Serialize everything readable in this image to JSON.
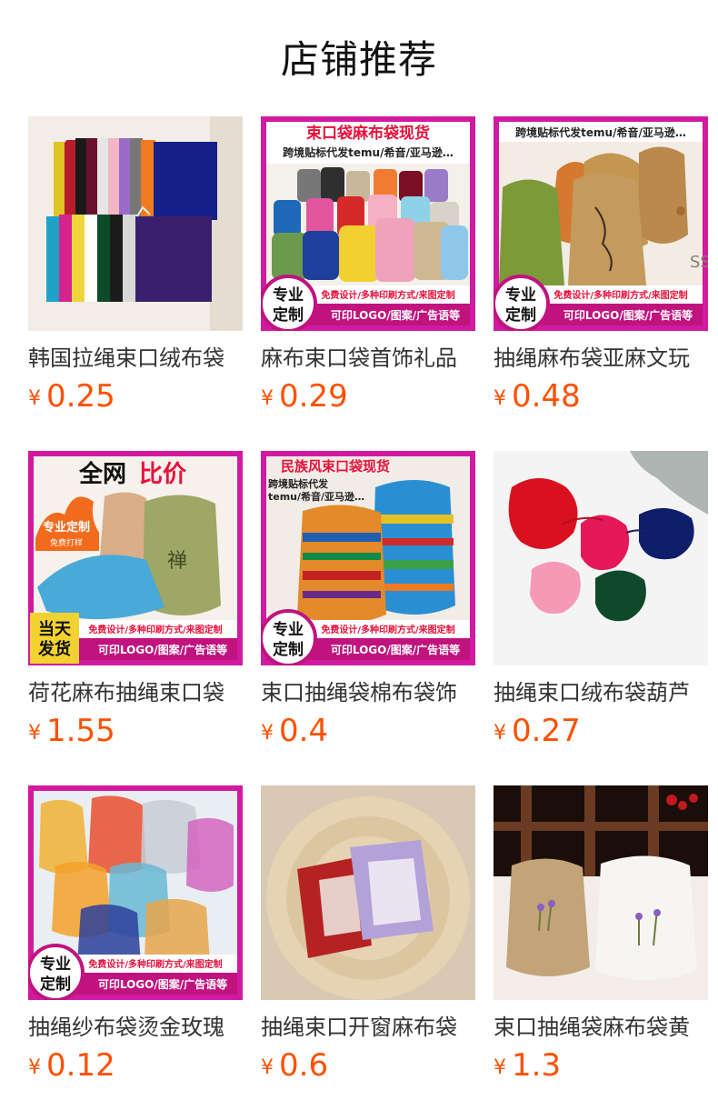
{
  "section_title": "店铺推荐",
  "currency_symbol": "¥",
  "products": [
    {
      "name": "韩国拉绳束口绒布袋",
      "price": "0.25",
      "image": {
        "kind": "velvet-rainbow"
      }
    },
    {
      "name": "麻布束口袋首饰礼品",
      "price": "0.29",
      "image": {
        "kind": "burlap-colors",
        "banner_top": "束口袋麻布袋现货",
        "banner_sub": "跨境贴标代发temu/希音/亚马逊…",
        "badge": "专业定制",
        "strip_top": "免费设计/多种印刷方式/来图定制",
        "strip_bottom": "可印LOGO/图案/广告语等"
      }
    },
    {
      "name": "抽绳麻布袋亚麻文玩",
      "price": "0.48",
      "image": {
        "kind": "linen-bags",
        "banner_sub": "跨境贴标代发temu/希音/亚马逊…",
        "badge": "专业定制",
        "strip_top": "免费设计/多种印刷方式/来图定制",
        "strip_bottom": "可印LOGO/图案/广告语等"
      }
    },
    {
      "name": "荷花麻布抽绳束口袋",
      "price": "1.55",
      "image": {
        "kind": "lotus-bags",
        "banner_top_black": "全网",
        "banner_top_red": "比价",
        "flame_text": "专业定制",
        "flame_sub": "免费打样",
        "bag_text": "禅",
        "badge": "当天发货",
        "strip_top": "免费设计/多种印刷方式/来图定制",
        "strip_bottom": "可印LOGO/图案/广告语等"
      }
    },
    {
      "name": "束口抽绳袋棉布袋饰",
      "price": "0.4",
      "image": {
        "kind": "ethnic-bags",
        "banner_top": "民族风束口袋现货",
        "banner_sub1": "跨境贴标代发",
        "banner_sub2": "temu/希音/亚马逊…",
        "badge": "专业定制",
        "strip_top": "免费设计/多种印刷方式/来图定制",
        "strip_bottom": "可印LOGO/图案/广告语等"
      }
    },
    {
      "name": "抽绳束口绒布袋葫芦",
      "price": "0.27",
      "image": {
        "kind": "gourd-velvet"
      }
    },
    {
      "name": "抽绳纱布袋烫金玫瑰",
      "price": "0.12",
      "image": {
        "kind": "organza",
        "badge": "专业定制",
        "strip_top": "免费设计/多种印刷方式/来图定制",
        "strip_bottom": "可印LOGO/图案/广告语等"
      }
    },
    {
      "name": "抽绳束口开窗麻布袋",
      "price": "0.6",
      "image": {
        "kind": "window-bags"
      }
    },
    {
      "name": "束口抽绳袋麻布袋黄",
      "price": "1.3",
      "image": {
        "kind": "lavender-bags"
      }
    }
  ],
  "colors": {
    "price": "#ff5000",
    "banner_red": "#e8103a",
    "banner_pink": "#d11aa0",
    "strip_magenta": "#c0137e"
  }
}
